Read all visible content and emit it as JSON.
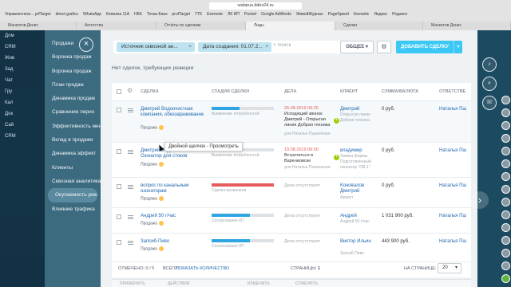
{
  "browser": {
    "url": "vodarus.bitrix24.ru",
    "bookmarks": [
      "Управленчеcк... prfTarget",
      "direct.grafics",
      "WhatsApp",
      "Копилка 11А",
      "НБ6",
      "Точка-Банк",
      "profTarget",
      "ТТК",
      "Evernote",
      "ЛК ИП",
      "Pocket",
      "Google AdWords",
      "ЖивойЖурнал",
      "PageSpeed",
      "Keenetic",
      "Яндекс",
      "Редакся"
    ],
    "tabs": [
      "Манкотов Денис",
      "Агентства",
      "Отчёты по сделкам",
      "Лиды",
      "Сделки",
      "Манкотов Денис"
    ]
  },
  "leftnav": {
    "items": [
      "Дом",
      "CRM",
      "Жив",
      "Зад",
      "Чат",
      "Гру",
      "Кал",
      "Док",
      "Сай",
      "CRM"
    ]
  },
  "submenu": {
    "items": [
      "Продажи",
      "Воронка продаж",
      "Воронка продаж",
      "План продаж",
      "Динамика продаж",
      "Сравнение перио",
      "Эффективность менед",
      "Вклад в продажи",
      "Динамика эффект",
      "Клиенты",
      "Сквозная аналитика",
      "Окупаемость рекл",
      "Влияние трафика"
    ]
  },
  "filters": {
    "chip1": "Источник сквозной ан...",
    "chip2": "Дата создания: 01.07.2...",
    "search_placeholder": "+ поиск",
    "all_button": "ОБЩЕЕ",
    "add_button": "ДОБАВИТЬ СДЕЛКУ"
  },
  "no_action_text": "Нет сделок, требующих реакции",
  "columns": {
    "deal": "СДЕЛКА",
    "stage": "СТАДИЯ СДЕЛКИ",
    "tasks": "ДЕЛА",
    "client": "КЛИЕНТ",
    "amount": "СУММА/ВАЛЮТА",
    "responsible": "ОТВЕТСТВЕ"
  },
  "rows": [
    {
      "title": "Дмитрий Водоочистная компания, обеззараживание",
      "type": "Продажа",
      "stage": "Выявление потребностей",
      "stage_fill": 0.45,
      "stage_color": "blue",
      "task_date": "26.08.2019 09:25",
      "task_text": "Исходящий звонок Дмитрий - Открытая линия Добрая техника",
      "task_owner": "для Наталья Пшеничная",
      "client_name": "Дмитрий",
      "client_sub": "Открытая линия Добрая техника",
      "amount": "0 руб.",
      "responsible": "Наталья Пш"
    },
    {
      "title": "Дмитрий Водоочистная Озонатор для стоков",
      "type": "Продажа",
      "stage": "Выявление потребностей",
      "stage_fill": 0.45,
      "stage_color": "blue",
      "task_date": "19.08.2019 09:00",
      "task_text": "Встретиться в Варениовске",
      "task_owner": "для Наталья Пшеничная",
      "client_name": "владимир",
      "client_sub": "Заявка формы Подготовленный озонатор \"ОВ-1\"",
      "amount": "0 руб.",
      "responsible": "Наталья Пш"
    },
    {
      "title": "вопрос по канальным озонаторам",
      "type": "Продажа",
      "stage": "Сделка провалена",
      "stage_fill": 1,
      "stage_color": "red",
      "task_date": "",
      "task_text": "Дела отсутствуют",
      "task_owner": "",
      "client_name": "Коновалов Дмитрий",
      "client_sub": "Физист",
      "amount": "0 руб.",
      "responsible": "Наталья Пш"
    },
    {
      "title": "Андрей 50 г/час",
      "type": "Продажа",
      "stage": "Согласование КП",
      "stage_fill": 0.62,
      "stage_color": "blue",
      "task_date": "",
      "task_text": "Дела отсутствуют",
      "task_owner": "",
      "client_name": "Андрей",
      "client_sub": "Андрей 50 г/час",
      "amount": "1 031 900 руб.",
      "responsible": "Наталья Пш"
    },
    {
      "title": "Запсиб-Пиво",
      "type": "Продажа",
      "stage": "Согласование КП",
      "stage_fill": 0.62,
      "stage_color": "blue",
      "task_date": "",
      "task_text": "Дела отсутствуют",
      "task_owner": "",
      "client_name": "Виктор Ильин",
      "client_sub": "Запсиб-Пиво",
      "amount": "443 900 руб.",
      "responsible": "Наталья Пш"
    }
  ],
  "tooltip": "Двойной щелчок - Просмотреть",
  "footer": {
    "selected": "ОТМЕЧЕНО: 0 / 5",
    "total_label": "ВСЕГО:",
    "total_link": "ПОКАЗАТЬ КОЛИЧЕСТВО",
    "pages_label": "СТРАНИЦЫ:",
    "page": "1",
    "per_page_label": "НА СТРАНИЦЕ:",
    "per_page": "20"
  },
  "bottom_toolbar": [
    "ПРИМЕНИТЬ",
    "ДЕЙСТВИЯ",
    "ИЗМЕНИТЬ",
    "ОТМЕНИТЬ"
  ],
  "colors": {
    "accent": "#3bc8f5",
    "link": "#2067b0",
    "stage_blue": "#2fa5e2",
    "stage_red": "#e65b5b"
  }
}
